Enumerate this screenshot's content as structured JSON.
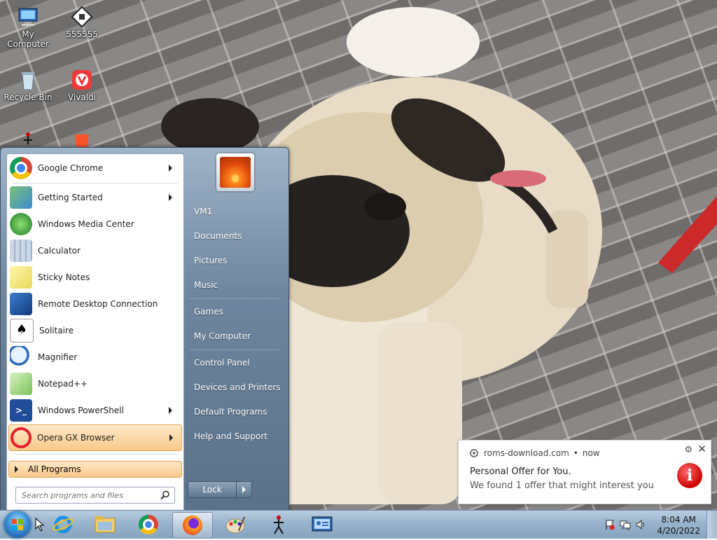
{
  "desktop": {
    "icons": [
      {
        "label": "My Computer",
        "icon": "computer-icon"
      },
      {
        "label": "555555",
        "icon": "film-icon"
      },
      {
        "label": "Recycle Bin",
        "icon": "recycle-bin-icon"
      },
      {
        "label": "Vivaldi",
        "icon": "vivaldi-icon"
      }
    ]
  },
  "start_menu": {
    "programs": [
      {
        "label": "Google Chrome",
        "icon": "chrome-icon",
        "submenu": true
      },
      {
        "label": "Getting Started",
        "icon": "getting-started-icon",
        "submenu": true
      },
      {
        "label": "Windows Media Center",
        "icon": "media-center-icon",
        "submenu": false
      },
      {
        "label": "Calculator",
        "icon": "calculator-icon",
        "submenu": false
      },
      {
        "label": "Sticky Notes",
        "icon": "sticky-notes-icon",
        "submenu": false
      },
      {
        "label": "Remote Desktop Connection",
        "icon": "remote-desktop-icon",
        "submenu": false
      },
      {
        "label": "Solitaire",
        "icon": "solitaire-icon",
        "submenu": false
      },
      {
        "label": "Magnifier",
        "icon": "magnifier-icon",
        "submenu": false
      },
      {
        "label": "Notepad++",
        "icon": "notepadpp-icon",
        "submenu": false
      },
      {
        "label": "Windows PowerShell",
        "icon": "powershell-icon",
        "submenu": true
      },
      {
        "label": "Opera GX Browser",
        "icon": "opera-gx-icon",
        "submenu": true
      }
    ],
    "all_programs": "All Programs",
    "search_placeholder": "Search programs and files",
    "right_links": [
      "VM1",
      "Documents",
      "Pictures",
      "Music",
      "Games",
      "My Computer",
      "Control Panel",
      "Devices and Printers",
      "Default Programs",
      "Help and Support"
    ],
    "lock_label": "Lock"
  },
  "taskbar": {
    "pinned": [
      "internet-explorer-icon",
      "explorer-folder-icon",
      "chrome-icon",
      "firefox-icon",
      "paint-icon",
      "stickman-icon",
      "control-panel-icon"
    ],
    "active": "firefox-icon",
    "clock_time": "8:04 AM",
    "clock_date": "4/20/2022"
  },
  "notification": {
    "source": "roms-download.com",
    "when": "now",
    "title": "Personal Offer for You.",
    "body": "We found 1 offer that might interest you",
    "settings_glyph": "⚙",
    "close_glyph": "✕",
    "info_glyph": "i"
  },
  "colors": {
    "highlight": "#f8c989",
    "start_menu_blue": "#6e869f",
    "taskbar": "#98b3cc"
  }
}
